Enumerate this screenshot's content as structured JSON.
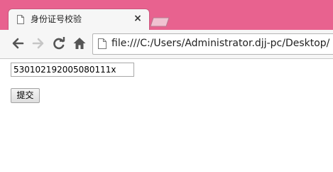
{
  "browser": {
    "tab": {
      "title": "身份证号校验",
      "icon": "document-icon",
      "close_icon": "close-icon"
    },
    "toolbar": {
      "back_icon": "back-arrow-icon",
      "forward_icon": "forward-arrow-icon",
      "reload_icon": "reload-icon",
      "home_icon": "home-icon"
    },
    "address_bar": {
      "url": "file:///C:/Users/Administrator.djj-pc/Desktop/",
      "icon": "page-icon"
    },
    "colors": {
      "frame": "#e8628f",
      "toolbar": "#f6f6f6",
      "content": "#ffffff"
    }
  },
  "page": {
    "id_input": {
      "value": "530102192005080111x"
    },
    "submit_label": "提交"
  }
}
